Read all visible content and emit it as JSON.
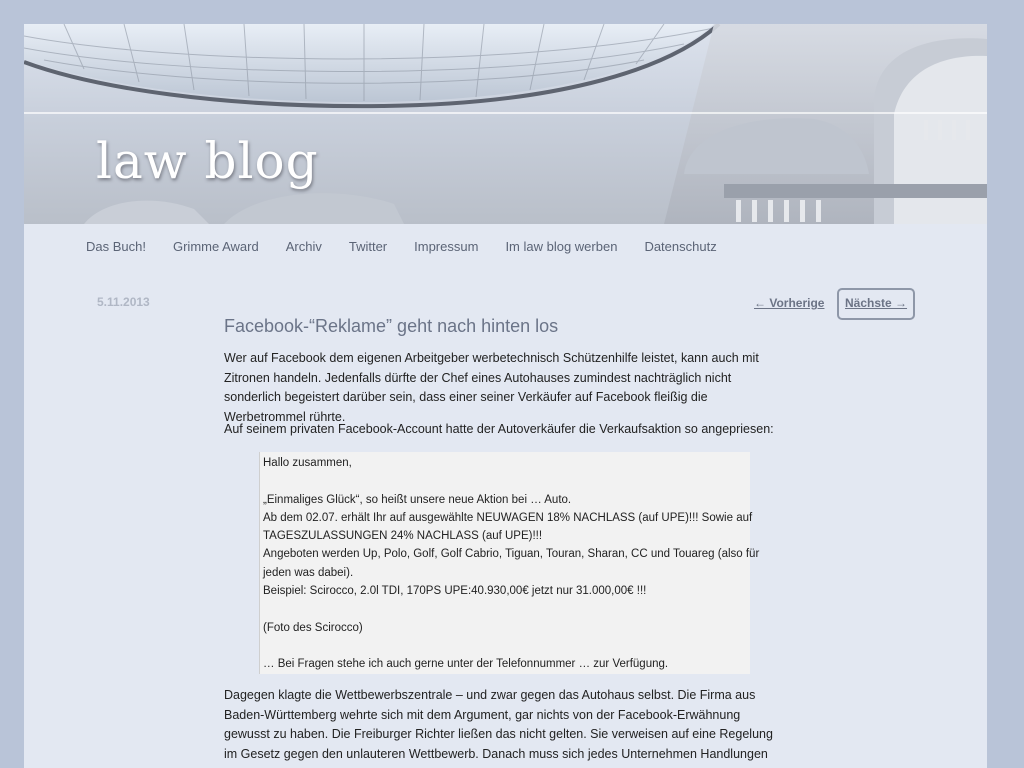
{
  "site": {
    "title": "law blog"
  },
  "nav": {
    "items": [
      "Das Buch!",
      "Grimme Award",
      "Archiv",
      "Twitter",
      "Impressum",
      "Im law blog werben",
      "Datenschutz"
    ]
  },
  "post": {
    "date": "5.11.2013",
    "prev_label": "← Vorherige",
    "next_label": "Nächste →",
    "title": "Facebook-“Reklame” geht nach hinten los",
    "para1": "Wer auf Facebook dem eigenen Arbeitgeber werbetechnisch Schützenhilfe leistet, kann auch mit Zitronen handeln. Jedenfalls dürfte der Chef eines Autohauses zumindest nachträglich nicht sonderlich begeistert darüber sein, dass einer seiner Verkäufer auf Facebook fleißig die Werbetrommel rührte.",
    "para2": "Auf seinem privaten Facebook-Account hatte der Autoverkäufer die Verkaufsaktion so angepriesen:",
    "quote": {
      "line1": "Hallo zusammen,",
      "line2": "„Einmaliges Glück“, so heißt unsere neue Aktion bei … Auto.",
      "line3": "Ab dem 02.07. erhält Ihr auf ausgewählte NEUWAGEN 18% NACHLASS (auf UPE)!!! Sowie auf",
      "line4": "TAGESZULASSUNGEN 24% NACHLASS (auf UPE)!!!",
      "line5": "Angeboten werden Up, Polo, Golf, Golf Cabrio, Tiguan, Touran, Sharan, CC und Touareg (also für",
      "line6": "jeden was dabei).",
      "line7": "Beispiel: Scirocco, 2.0l TDI, 170PS UPE:40.930,00€ jetzt nur 31.000,00€ !!!",
      "line8": "(Foto des Scirocco)",
      "line9": "… Bei Fragen stehe ich auch gerne unter der Telefonnummer … zur Verfügung."
    },
    "para3": "Dagegen klagte die Wettbewerbszentrale – und zwar gegen das Autohaus selbst. Die Firma aus Baden-Württemberg wehrte sich mit dem Argument, gar nichts von der Facebook-Erwähnung gewusst zu haben. Die Freiburger Richter ließen das nicht gelten. Sie verweisen auf eine Regelung im Gesetz gegen den unlauteren Wettbewerb. Danach muss sich jedes Unternehmen Handlungen von"
  },
  "colors": {
    "page_background": "#b9c4d8",
    "content_background": "#e3e8f2",
    "nav_text": "#5b6476",
    "title_text": "#6b7488"
  }
}
